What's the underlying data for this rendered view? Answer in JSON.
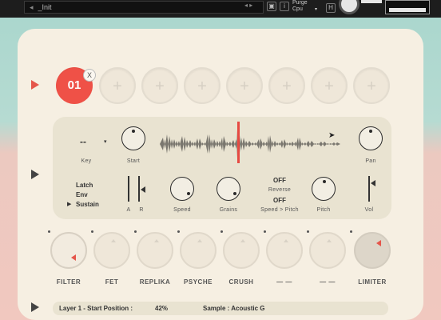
{
  "host": {
    "preset_name": "_Init",
    "purge_label": "Purge",
    "purge_sub": "Cpu",
    "badge": "H"
  },
  "layers": {
    "active_number": "01",
    "empty_slot_symbol": "+",
    "close_symbol": "X",
    "slot_count": 8
  },
  "layer_editor": {
    "key_value": "--",
    "key_label": "Key",
    "start_label": "Start",
    "pan_label": "Pan",
    "modes": [
      "Latch",
      "Env",
      "Sustain"
    ],
    "active_mode": "Sustain",
    "ar_labels": [
      "A",
      "R"
    ],
    "speed_label": "Speed",
    "grains_label": "Grains",
    "reverse_state": "OFF",
    "reverse_label": "Reverse",
    "speed_pitch_state": "OFF",
    "speed_pitch_label": "Speed > Pitch",
    "pitch_label": "Pitch",
    "vol_label": "Vol"
  },
  "effects": [
    {
      "label": "FILTER"
    },
    {
      "label": "FET"
    },
    {
      "label": "REPLIKA"
    },
    {
      "label": "PSYCHE"
    },
    {
      "label": "CRUSH"
    },
    {
      "label": "— —"
    },
    {
      "label": "— —"
    },
    {
      "label": "LIMITER"
    }
  ],
  "status": {
    "param_text": "Layer 1 - Start Position :",
    "param_value": "42%",
    "sample_text": "Sample : Acoustic G"
  },
  "colors": {
    "accent": "#ef5147",
    "panel": "#f6efe2",
    "editor_bg": "#e9e3d1"
  }
}
